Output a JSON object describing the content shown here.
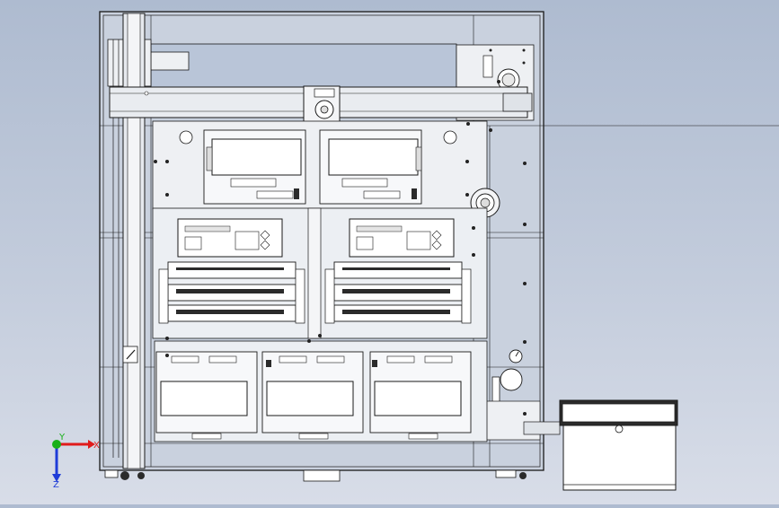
{
  "viewport": {
    "background_top": "#aebbd0",
    "background_bottom": "#d8dde8"
  },
  "drawing": {
    "line_color": "#1a1a1a",
    "fill_light": "#ffffff",
    "fill_panel": "#eef0f3",
    "fill_metal": "#d9dde3",
    "fill_dark": "#2b2b2b"
  },
  "triad": {
    "x_label": "X",
    "y_label": "Y",
    "z_label": "Z",
    "x_color": "#e01b1b",
    "y_color": "#18b018",
    "z_color": "#1e3cd8"
  },
  "icons": {
    "triad": "coordinate-axes-icon",
    "gauges": "pressure-gauge-icon"
  }
}
